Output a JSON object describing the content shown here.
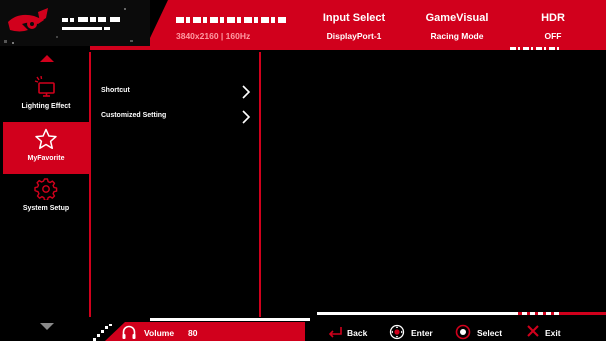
{
  "header": {
    "resolution": "3840x2160 | 160Hz",
    "status": [
      {
        "label": "Input Select",
        "value": "DisplayPort-1"
      },
      {
        "label": "GameVisual",
        "value": "Racing Mode"
      },
      {
        "label": "HDR",
        "value": "OFF"
      }
    ]
  },
  "sidebar": {
    "items": [
      {
        "label": "Lighting Effect",
        "icon": "monitor-light-icon",
        "active": false
      },
      {
        "label": "MyFavorite",
        "icon": "star-icon",
        "active": true
      },
      {
        "label": "System Setup",
        "icon": "gear-icon",
        "active": false
      }
    ]
  },
  "main": {
    "items": [
      {
        "label": "Shortcut"
      },
      {
        "label": "Customized Setting"
      }
    ]
  },
  "footer": {
    "volume_label": "Volume",
    "volume_value": "80",
    "nav": [
      {
        "label": "Back",
        "icon": "back-arrow-icon"
      },
      {
        "label": "Enter",
        "icon": "joystick-icon"
      },
      {
        "label": "Select",
        "icon": "select-icon"
      },
      {
        "label": "Exit",
        "icon": "close-icon"
      }
    ]
  },
  "colors": {
    "accent": "#d1001c",
    "background": "#000000",
    "text": "#ffffff"
  }
}
